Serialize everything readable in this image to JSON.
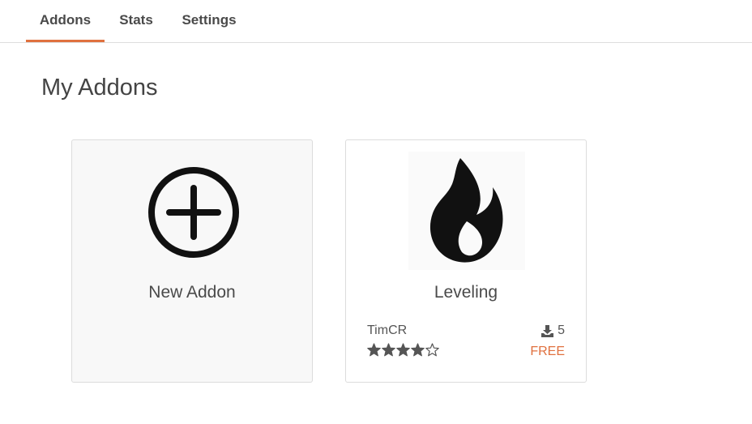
{
  "tabs": [
    {
      "label": "Addons",
      "active": true
    },
    {
      "label": "Stats",
      "active": false
    },
    {
      "label": "Settings",
      "active": false
    }
  ],
  "page": {
    "title": "My Addons"
  },
  "cards": {
    "new_addon": {
      "title": "New Addon",
      "icon": "plus-circle-icon"
    },
    "addons": [
      {
        "title": "Leveling",
        "thumbnail_icon": "flame-icon",
        "author": "TimCR",
        "downloads": "5",
        "downloads_icon": "download-icon",
        "rating": 4,
        "rating_max": 5,
        "price": "FREE"
      }
    ]
  },
  "colors": {
    "accent": "#e0713f",
    "text": "#4a4a4a",
    "border": "#dcdcdc",
    "new_card_bg": "#f8f8f8"
  }
}
